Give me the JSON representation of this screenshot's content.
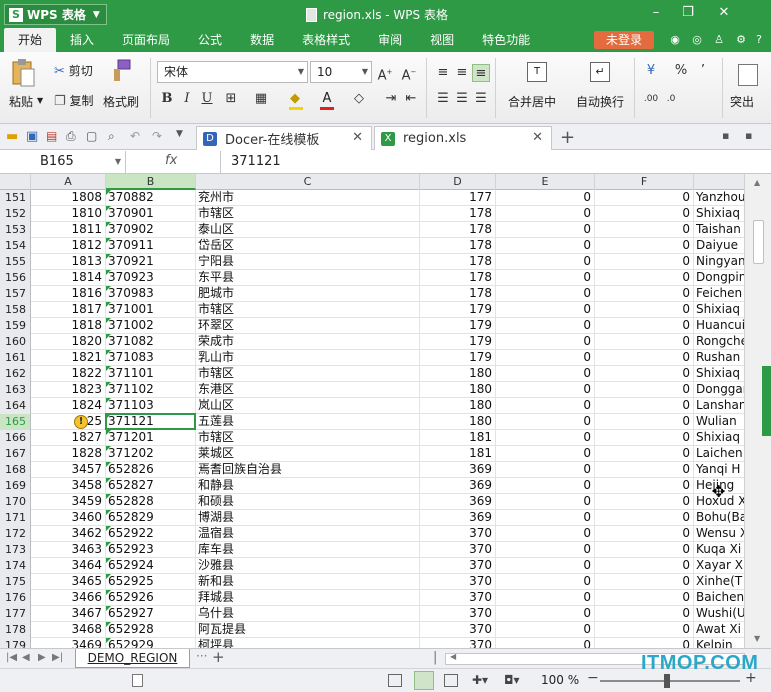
{
  "app": {
    "name": "WPS 表格",
    "window_title": "region.xls - WPS 表格",
    "login_label": "未登录"
  },
  "ribbon_tabs": [
    "开始",
    "插入",
    "页面布局",
    "公式",
    "数据",
    "表格样式",
    "审阅",
    "视图",
    "特色功能"
  ],
  "ribbon": {
    "paste": "粘贴",
    "cut": "剪切",
    "copy": "复制",
    "format_painter": "格式刷",
    "font_name": "宋体",
    "font_size": "10",
    "bold": "B",
    "italic": "I",
    "underline": "U",
    "merge_center": "合并居中",
    "auto_wrap": "自动换行",
    "percent": "%",
    "comma": "’",
    "highlight_partial": "突出"
  },
  "doc_tabs": [
    {
      "label": "Docer-在线模板",
      "active": false
    },
    {
      "label": "region.xls",
      "active": true
    }
  ],
  "formula_bar": {
    "name_box": "B165",
    "fx": "fx",
    "value": "371121"
  },
  "columns": [
    "A",
    "B",
    "C",
    "D",
    "E",
    "F",
    ""
  ],
  "rows": [
    {
      "n": "151",
      "a": "1808",
      "b": "370882",
      "c": "兖州市",
      "d": "177",
      "e": "0",
      "f": "0",
      "g": "Yanzhou"
    },
    {
      "n": "152",
      "a": "1810",
      "b": "370901",
      "c": "市辖区",
      "d": "178",
      "e": "0",
      "f": "0",
      "g": "Shixiaq"
    },
    {
      "n": "153",
      "a": "1811",
      "b": "370902",
      "c": "泰山区",
      "d": "178",
      "e": "0",
      "f": "0",
      "g": "Taishan"
    },
    {
      "n": "154",
      "a": "1812",
      "b": "370911",
      "c": "岱岳区",
      "d": "178",
      "e": "0",
      "f": "0",
      "g": "Daiyue"
    },
    {
      "n": "155",
      "a": "1813",
      "b": "370921",
      "c": "宁阳县",
      "d": "178",
      "e": "0",
      "f": "0",
      "g": "Ningyan"
    },
    {
      "n": "156",
      "a": "1814",
      "b": "370923",
      "c": "东平县",
      "d": "178",
      "e": "0",
      "f": "0",
      "g": "Dongpin"
    },
    {
      "n": "157",
      "a": "1816",
      "b": "370983",
      "c": "肥城市",
      "d": "178",
      "e": "0",
      "f": "0",
      "g": "Feichen"
    },
    {
      "n": "158",
      "a": "1817",
      "b": "371001",
      "c": "市辖区",
      "d": "179",
      "e": "0",
      "f": "0",
      "g": "Shixiaq"
    },
    {
      "n": "159",
      "a": "1818",
      "b": "371002",
      "c": "环翠区",
      "d": "179",
      "e": "0",
      "f": "0",
      "g": "Huancui"
    },
    {
      "n": "160",
      "a": "1820",
      "b": "371082",
      "c": "荣成市",
      "d": "179",
      "e": "0",
      "f": "0",
      "g": "Rongche"
    },
    {
      "n": "161",
      "a": "1821",
      "b": "371083",
      "c": "乳山市",
      "d": "179",
      "e": "0",
      "f": "0",
      "g": "Rushan"
    },
    {
      "n": "162",
      "a": "1822",
      "b": "371101",
      "c": "市辖区",
      "d": "180",
      "e": "0",
      "f": "0",
      "g": "Shixiaq"
    },
    {
      "n": "163",
      "a": "1823",
      "b": "371102",
      "c": "东港区",
      "d": "180",
      "e": "0",
      "f": "0",
      "g": "Donggan"
    },
    {
      "n": "164",
      "a": "1824",
      "b": "371103",
      "c": "岚山区",
      "d": "180",
      "e": "0",
      "f": "0",
      "g": "Lanshan"
    },
    {
      "n": "165",
      "a": "25",
      "b": "371121",
      "c": "五莲县",
      "d": "180",
      "e": "0",
      "f": "0",
      "g": "Wulian"
    },
    {
      "n": "166",
      "a": "1827",
      "b": "371201",
      "c": "市辖区",
      "d": "181",
      "e": "0",
      "f": "0",
      "g": "Shixiaq"
    },
    {
      "n": "167",
      "a": "1828",
      "b": "371202",
      "c": "莱城区",
      "d": "181",
      "e": "0",
      "f": "0",
      "g": "Laichen"
    },
    {
      "n": "168",
      "a": "3457",
      "b": "652826",
      "c": "焉耆回族自治县",
      "d": "369",
      "e": "0",
      "f": "0",
      "g": "Yanqi H"
    },
    {
      "n": "169",
      "a": "3458",
      "b": "652827",
      "c": "和静县",
      "d": "369",
      "e": "0",
      "f": "0",
      "g": "Hejing"
    },
    {
      "n": "170",
      "a": "3459",
      "b": "652828",
      "c": "和硕县",
      "d": "369",
      "e": "0",
      "f": "0",
      "g": "Hoxud X"
    },
    {
      "n": "171",
      "a": "3460",
      "b": "652829",
      "c": "博湖县",
      "d": "369",
      "e": "0",
      "f": "0",
      "g": "Bohu(Ba"
    },
    {
      "n": "172",
      "a": "3462",
      "b": "652922",
      "c": "温宿县",
      "d": "370",
      "e": "0",
      "f": "0",
      "g": "Wensu X"
    },
    {
      "n": "173",
      "a": "3463",
      "b": "652923",
      "c": "库车县",
      "d": "370",
      "e": "0",
      "f": "0",
      "g": "Kuqa Xi"
    },
    {
      "n": "174",
      "a": "3464",
      "b": "652924",
      "c": "沙雅县",
      "d": "370",
      "e": "0",
      "f": "0",
      "g": "Xayar X"
    },
    {
      "n": "175",
      "a": "3465",
      "b": "652925",
      "c": "新和县",
      "d": "370",
      "e": "0",
      "f": "0",
      "g": "Xinhe(T"
    },
    {
      "n": "176",
      "a": "3466",
      "b": "652926",
      "c": "拜城县",
      "d": "370",
      "e": "0",
      "f": "0",
      "g": "Baichen"
    },
    {
      "n": "177",
      "a": "3467",
      "b": "652927",
      "c": "乌什县",
      "d": "370",
      "e": "0",
      "f": "0",
      "g": "Wushi(U"
    },
    {
      "n": "178",
      "a": "3468",
      "b": "652928",
      "c": "阿瓦提县",
      "d": "370",
      "e": "0",
      "f": "0",
      "g": "Awat Xi"
    },
    {
      "n": "179",
      "a": "3469",
      "b": "652929",
      "c": "柯坪县",
      "d": "370",
      "e": "0",
      "f": "0",
      "g": "Kelpin"
    }
  ],
  "selected": {
    "row": "165",
    "col": "B"
  },
  "sheet_tabs": [
    "DEMO_REGION"
  ],
  "status": {
    "zoom": "100 %"
  },
  "watermark": "ITMOP.COM",
  "colors": {
    "accent": "#2f9a45",
    "login": "#e36b3d",
    "selection": "#2f9a45"
  },
  "icons": [
    "wps-logo-icon",
    "document-icon",
    "skin-icon",
    "shirt-icon",
    "help-icon",
    "paste-icon",
    "scissors-icon",
    "copy-icon",
    "brush-icon"
  ]
}
